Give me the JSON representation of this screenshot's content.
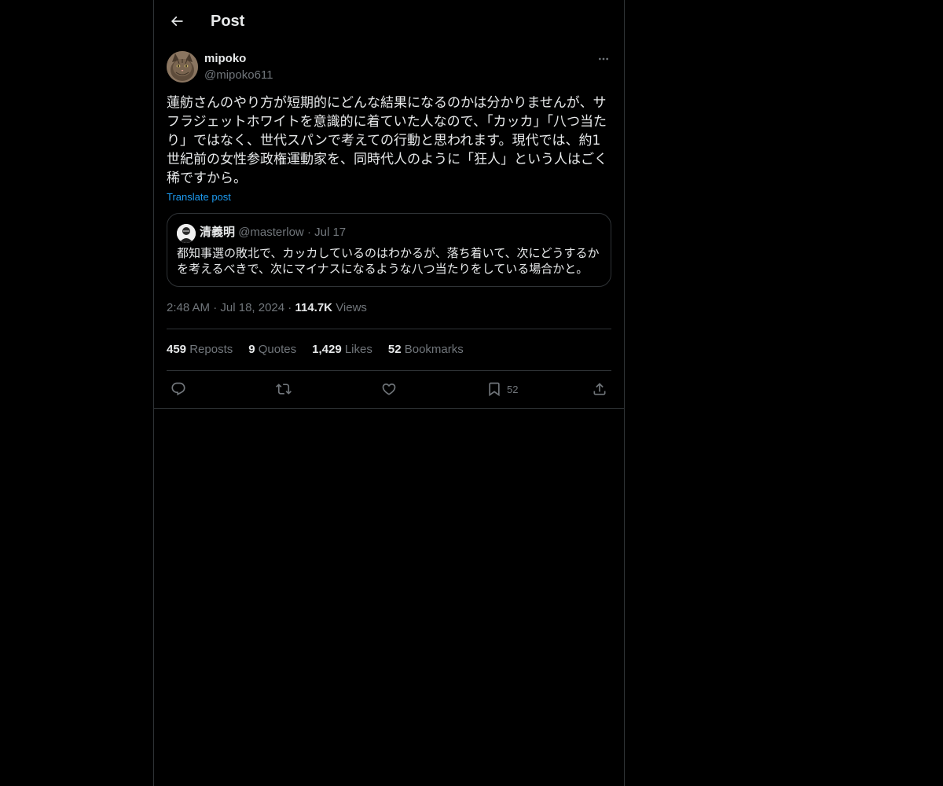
{
  "header": {
    "title": "Post"
  },
  "author": {
    "name": "mipoko",
    "handle": "@mipoko611"
  },
  "post": {
    "text": "蓮舫さんのやり方が短期的にどんな結果になるのかは分かりませんが、サフラジェットホワイトを意識的に着ていた人なので、「カッカ」「八つ当たり」ではなく、世代スパンで考えての行動と思われます。現代では、約1世紀前の女性参政権運動家を、同時代人のように「狂人」という人はごく稀ですから。",
    "translate_label": "Translate post"
  },
  "quote": {
    "name": "清義明",
    "handle": "@masterlow",
    "separator": "·",
    "date": "Jul 17",
    "text": "都知事選の敗北で、カッカしているのはわかるが、落ち着いて、次にどうするかを考えるべきで、次にマイナスになるような八つ当たりをしている場合かと。"
  },
  "meta": {
    "time": "2:48 AM",
    "separator": "·",
    "date": "Jul 18, 2024",
    "views_count": "114.7K",
    "views_label": "Views"
  },
  "stats": {
    "reposts_count": "459",
    "reposts_label": "Reposts",
    "quotes_count": "9",
    "quotes_label": "Quotes",
    "likes_count": "1,429",
    "likes_label": "Likes",
    "bookmarks_count": "52",
    "bookmarks_label": "Bookmarks"
  },
  "actions": {
    "bookmark_count": "52"
  },
  "colors": {
    "background": "#000000",
    "text": "#e7e9ea",
    "muted": "#71767b",
    "accent": "#1d9bf0",
    "border": "#2f3336"
  },
  "icons": {
    "back": "back-arrow-icon",
    "more": "more-icon",
    "reply": "reply-icon",
    "repost": "repost-icon",
    "like": "heart-icon",
    "bookmark": "bookmark-icon",
    "share": "share-icon"
  }
}
